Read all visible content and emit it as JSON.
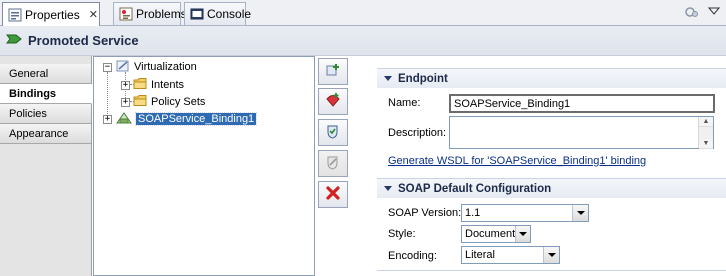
{
  "tabs": [
    {
      "label": "Properties",
      "close": "✕",
      "icon": "properties-icon",
      "active": true
    },
    {
      "label": "Problems",
      "icon": "problems-icon"
    },
    {
      "label": "Console",
      "icon": "console-icon"
    }
  ],
  "header": {
    "title": "Promoted Service",
    "icon": "promoted-service-arrow-icon"
  },
  "nav": {
    "items": [
      {
        "label": "General"
      },
      {
        "label": "Bindings",
        "selected": true
      },
      {
        "label": "Policies"
      },
      {
        "label": "Appearance"
      }
    ]
  },
  "tree": {
    "root": {
      "label": "Virtualization",
      "icon": "virtualization-icon",
      "expander": "−"
    },
    "children": [
      {
        "label": "Intents",
        "icon": "folder-icon",
        "expander": "+"
      },
      {
        "label": "Policy Sets",
        "icon": "folder-icon",
        "expander": "+"
      }
    ],
    "binding": {
      "label": "SOAPService_Binding1",
      "icon": "soap-binding-icon",
      "expander": "+",
      "selected": true
    }
  },
  "actions": [
    {
      "icon": "add-binding-icon",
      "enabled": true
    },
    {
      "icon": "add-intent-icon",
      "enabled": true
    },
    {
      "icon": "add-policy-set-icon",
      "enabled": true
    },
    {
      "icon": "edit-icon",
      "enabled": false
    },
    {
      "icon": "delete-icon",
      "enabled": true
    }
  ],
  "endpoint": {
    "section_title": "Endpoint",
    "name_label": "Name:",
    "name_value": "SOAPService_Binding1",
    "description_label": "Description:",
    "description_value": "",
    "wsdl_link": "Generate WSDL for 'SOAPService_Binding1'  binding"
  },
  "soap": {
    "section_title": "SOAP Default Configuration",
    "version_label": "SOAP Version:",
    "version_value": "1.1",
    "style_label": "Style:",
    "style_value": "Document",
    "encoding_label": "Encoding:",
    "encoding_value": "Literal"
  },
  "colors": {
    "accent": "#2f6bb3",
    "link": "#0b2f8a",
    "delete": "#d21f1f"
  }
}
